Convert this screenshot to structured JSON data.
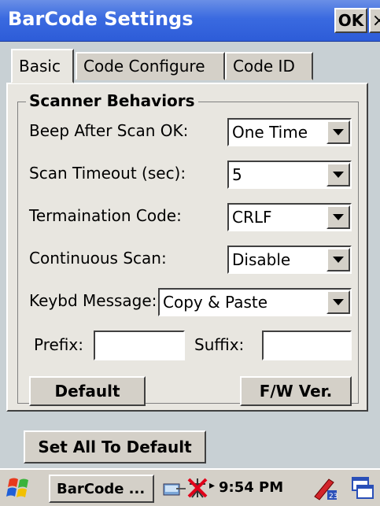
{
  "window": {
    "title": "BarCode Settings",
    "ok_label": "OK",
    "close_label": "×"
  },
  "tabs": [
    {
      "label": "Basic",
      "active": true
    },
    {
      "label": "Code Configure",
      "active": false
    },
    {
      "label": "Code ID",
      "active": false
    }
  ],
  "group": {
    "title": "Scanner Behaviors"
  },
  "settings": {
    "beep_label": "Beep After Scan OK:",
    "beep_value": "One Time",
    "timeout_label": "Scan Timeout (sec):",
    "timeout_value": "5",
    "termination_label": "Termaination Code:",
    "termination_value": "CRLF",
    "continuous_label": "Continuous Scan:",
    "continuous_value": "Disable",
    "keybd_label": "Keybd Message:",
    "keybd_value": "Copy & Paste",
    "prefix_label": "Prefix:",
    "prefix_value": "",
    "suffix_label": "Suffix:",
    "suffix_value": ""
  },
  "buttons": {
    "default_label": "Default",
    "fw_label": "F/W Ver.",
    "set_all_label": "Set All To Default"
  },
  "taskbar": {
    "task_label": "BarCode ...",
    "clock": "9:54 PM"
  },
  "colors": {
    "titlebar": "#2d5cd8",
    "window_bg": "#d4d0c8"
  }
}
